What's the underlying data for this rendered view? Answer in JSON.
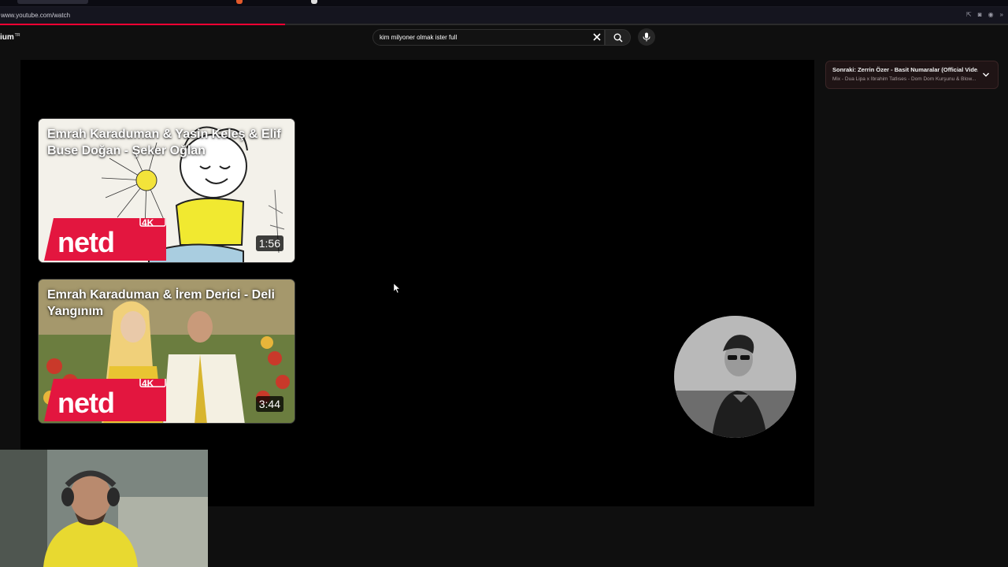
{
  "browser": {
    "url": "www.youtube.com/watch"
  },
  "header": {
    "logo_text": "ium",
    "region": "TR",
    "search_value": "kim milyoner olmak ister full"
  },
  "player": {
    "end_screen": [
      {
        "title": "Emrah Karaduman & Yasin Keleş & Elif Buse Doğan - Şeker Oğlan",
        "duration": "1:56",
        "badge": "4K",
        "brand": "netd"
      },
      {
        "title": "Emrah Karaduman & İrem Derici - Deli Yangınım",
        "duration": "3:44",
        "badge": "4K",
        "brand": "netd"
      }
    ]
  },
  "up_next": {
    "title": "Sonraki: Zerrin Özer - Basit Numaralar (Official Vide...",
    "subtitle": "Mix - Dua Lipa x İbrahim Tatlıses - Dom Dom Kurşunu & Blow..."
  },
  "colors": {
    "progress": "#ff0033",
    "netd_red": "#e3163f",
    "page_bg": "#0f0f0f",
    "player_bg": "#000000"
  }
}
